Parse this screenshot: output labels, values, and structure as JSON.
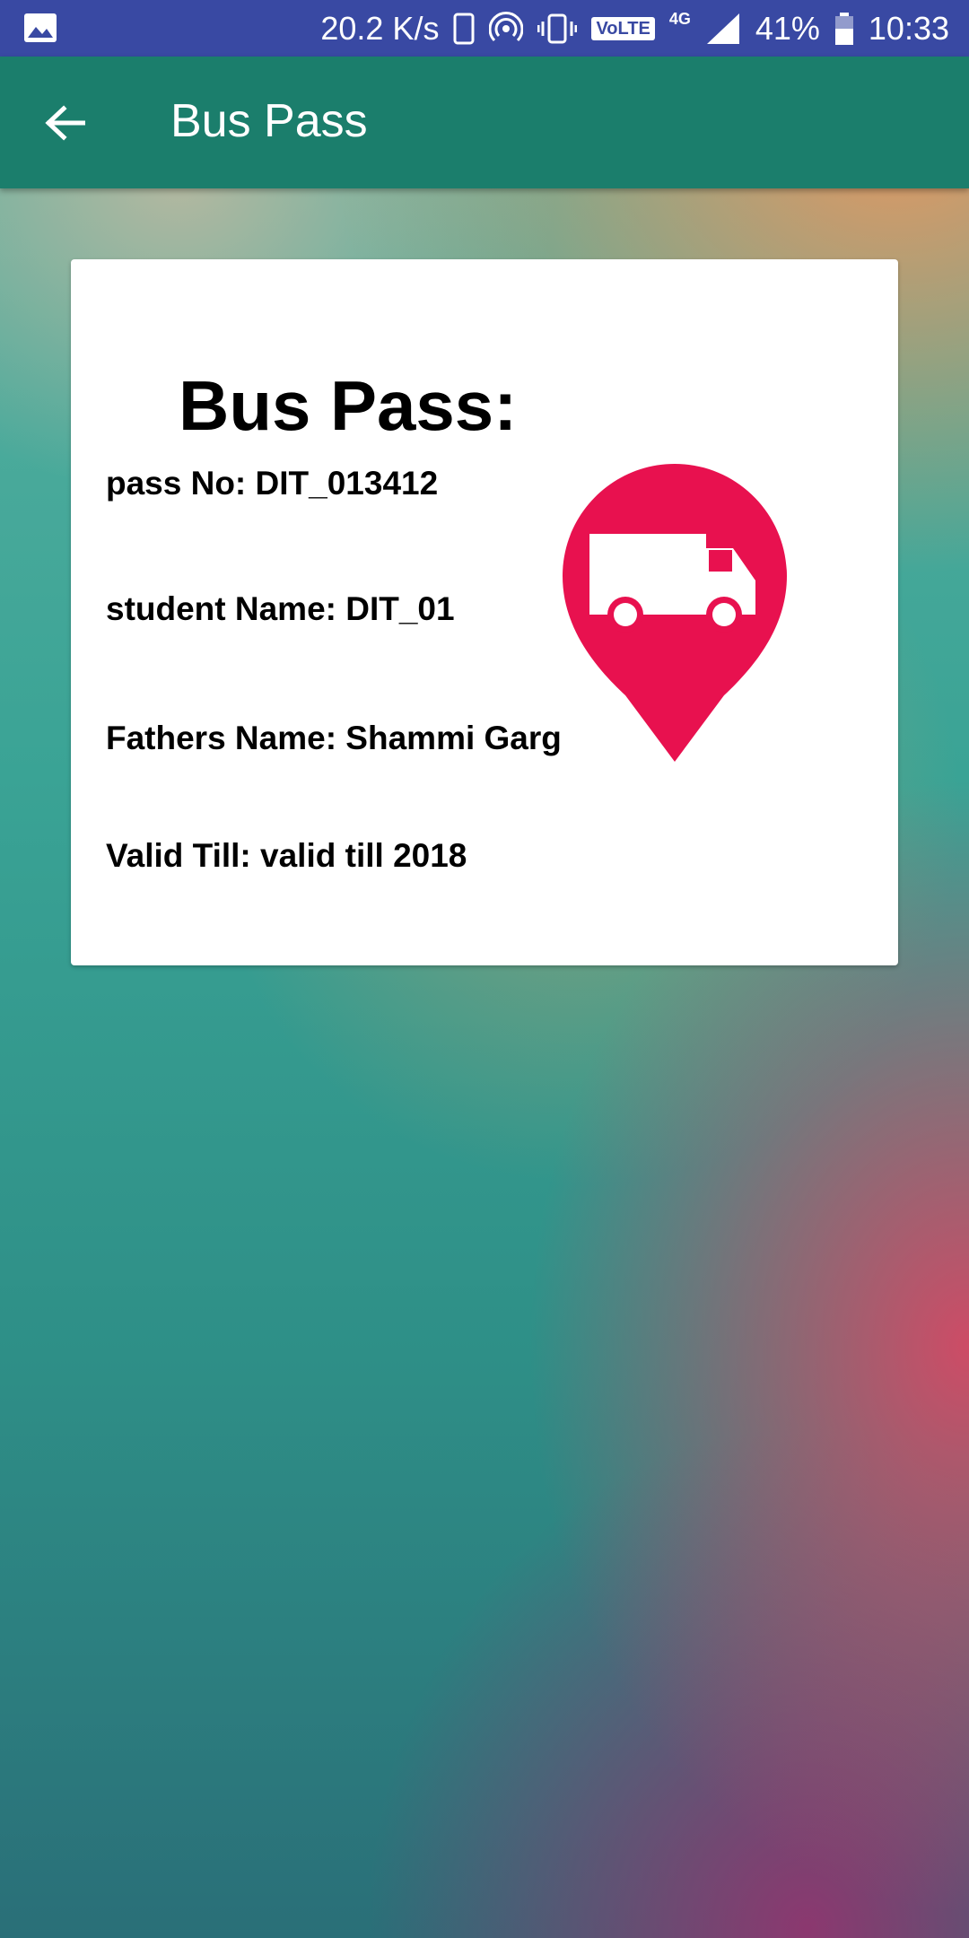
{
  "status_bar": {
    "speed": "20.2 K/s",
    "volte": "VoLTE",
    "network": "4G",
    "battery": "41%",
    "time": "10:33"
  },
  "app_bar": {
    "title": "Bus Pass"
  },
  "card": {
    "title": "Bus Pass:",
    "pass_no": "pass No: DIT_013412",
    "student_name": "student Name: DIT_01",
    "fathers_name": "Fathers Name: Shammi Garg",
    "valid_till": "Valid Till: valid till 2018"
  },
  "colors": {
    "status_bar": "#3949a3",
    "app_bar": "#1b7e6c",
    "pin": "#e8114f"
  }
}
